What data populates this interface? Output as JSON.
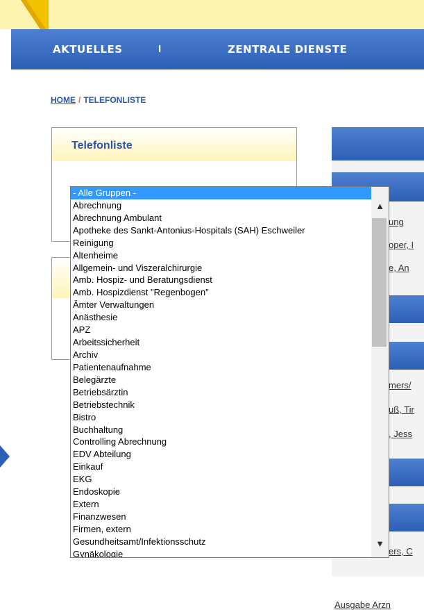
{
  "nav": {
    "items": [
      "AKTUELLES",
      "ZENTRALE DIENSTE"
    ],
    "separator": "I"
  },
  "breadcrumb": {
    "home": "HOME",
    "separator": "/",
    "current": "TELEFONLISTE"
  },
  "sidebar": {
    "card_title": "Telefonliste"
  },
  "dropdown": {
    "options": [
      "- Alle Gruppen -",
      "Abrechnung",
      "Abrechnung Ambulant",
      "Apotheke des Sankt-Antonius-Hospitals (SAH) Eschweiler",
      "Reinigung",
      "Altenheime",
      "Allgemein- und Viszeralchirurgie",
      "Amb. Hospiz- und Beratungsdienst",
      "Amb. Hospizdienst \"Regenbogen\"",
      "Ämter Verwaltungen",
      "Anästhesie",
      "APZ",
      "Arbeitssicherheit",
      "Archiv",
      "Patientenaufnahme",
      "Belegärzte",
      "Betriebsärztin",
      "Betriebstechnik",
      "Bistro",
      "Buchhaltung",
      "Controlling Abrechnung",
      "EDV Abteilung",
      "Einkauf",
      "EKG",
      "Endoskopie",
      "Extern",
      "Finanzwesen",
      "Firmen, extern",
      "Gesundheitsamt/Infektionsschutz",
      "Gynäkologie"
    ],
    "selected_index": 0
  },
  "right_column": {
    "lines": [
      "ung",
      "oper, I",
      "e, An",
      "mers/",
      "uß, Tir",
      ", Jess",
      "ers, C"
    ],
    "bottom": "Ausgabe Arzn"
  },
  "colors": {
    "nav_blue": "#2d5fb6",
    "header_yellow": "#fdf3b0",
    "link_blue": "#2b56a6",
    "selection_blue": "#3399ff"
  },
  "icons": {
    "scroll_up": "chevron-up-icon",
    "scroll_down": "chevron-down-icon",
    "arrow": "arrow-right-icon"
  }
}
